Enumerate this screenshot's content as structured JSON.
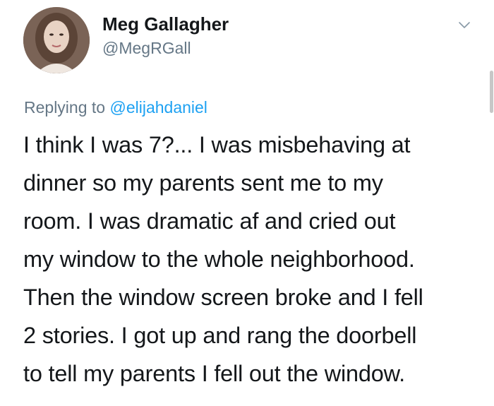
{
  "author": {
    "name": "Meg Gallagher",
    "handle": "@MegRGall"
  },
  "reply": {
    "prefix": "Replying to",
    "handle": "@elijahdaniel"
  },
  "tweet_lines": [
    "I think I was 7?... I was misbehaving at",
    "dinner so my parents sent me to my",
    "room. I was dramatic af and cried out",
    "my window to the whole neighborhood.",
    "Then the window screen broke and I fell",
    "2 stories. I got up and rang the doorbell",
    "to tell my parents I fell out the window."
  ],
  "icons": {
    "menu": "chevron-down-icon",
    "avatar": "profile-photo"
  },
  "colors": {
    "text": "#14171a",
    "secondary": "#657786",
    "link": "#1da1f2"
  }
}
